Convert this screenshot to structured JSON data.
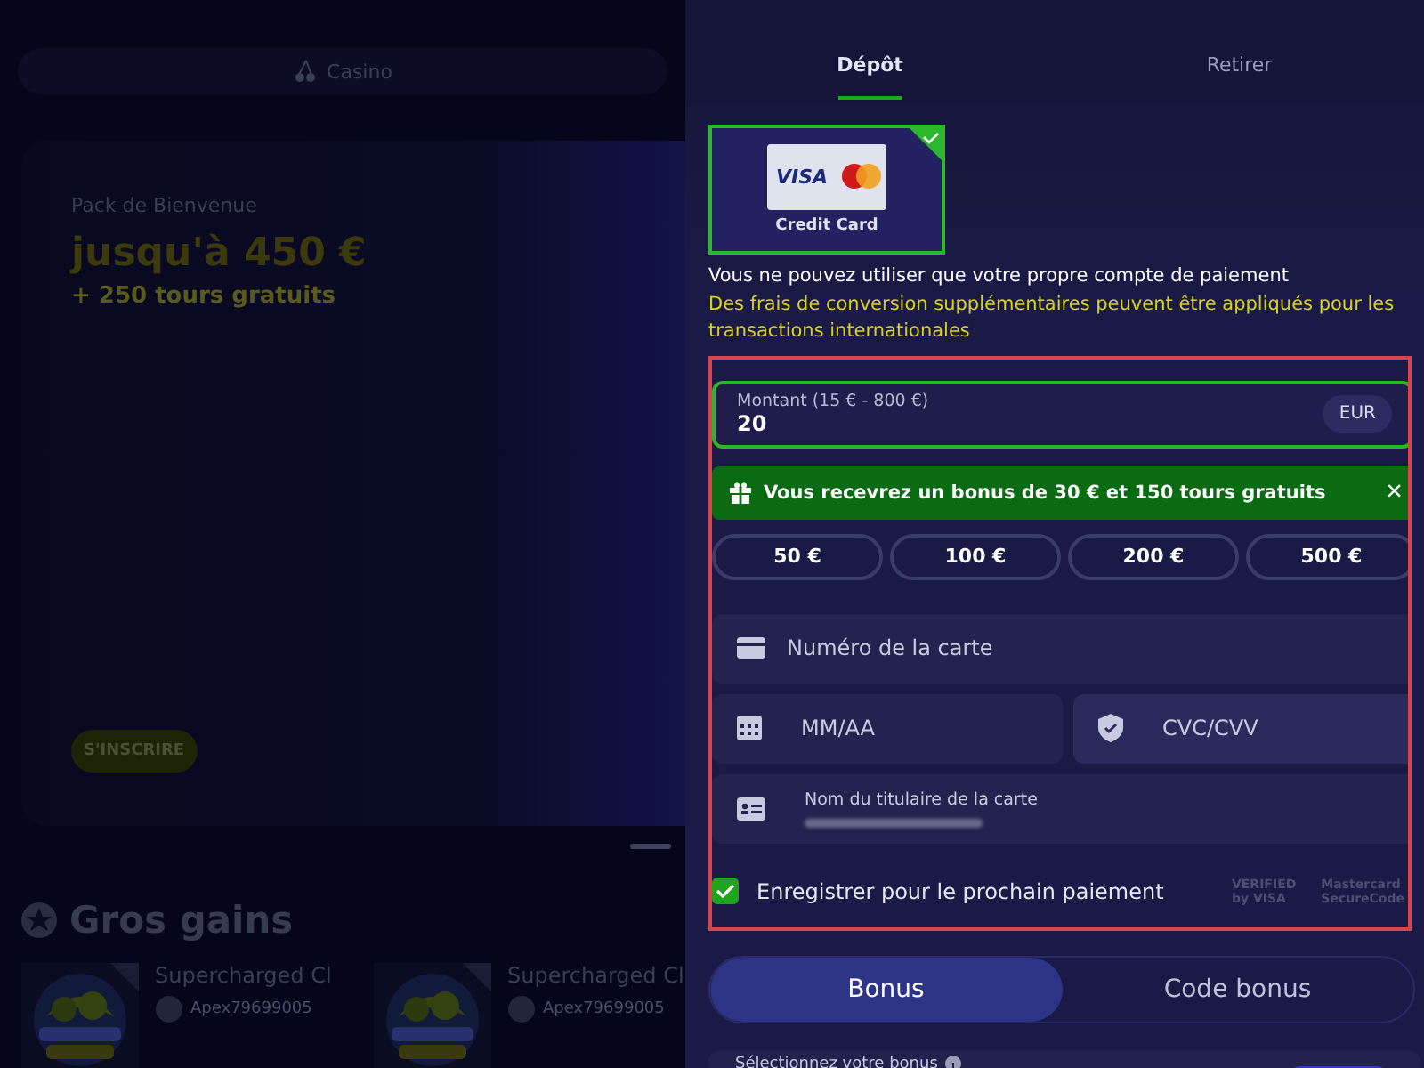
{
  "background_page": {
    "nav": {
      "label": "Casino"
    },
    "promo": {
      "title": "Pack de Bienvenue",
      "amount": "jusqu'à 450 €",
      "extra": "+ 250 tours gratuits",
      "button": "S'INSCRIRE"
    },
    "big_wins": {
      "title": "Gros gains",
      "items": [
        {
          "kind": "picture",
          "game": "Supercharged Cl",
          "player": "Apex79699005"
        },
        {
          "kind": "picture",
          "game": "Supercharged Cl",
          "player": "Apex79699005"
        }
      ]
    }
  },
  "tabs": [
    {
      "label": "Dépôt",
      "selected": true
    },
    {
      "label": "Retirer",
      "selected": false
    }
  ],
  "methods": [
    {
      "label": "Credit Card",
      "logo_text": "VISA",
      "selected": true
    }
  ],
  "notes": [
    {
      "kind": "plain",
      "text": "Vous ne pouvez utiliser que votre propre compte de paiement"
    },
    {
      "kind": "warning",
      "text": "Des frais de conversion supplémentaires peuvent être appliqués pour les transactions internationales"
    }
  ],
  "amount_field": {
    "label": "Montant (15 € - 800 €)",
    "value": "20",
    "currency": "EUR"
  },
  "bonus_banner": {
    "text": "Vous recevrez un bonus de 30 € et 150 tours gratuits",
    "close": "×"
  },
  "quick_amounts": [
    {
      "label": "50 €"
    },
    {
      "label": "100 €"
    },
    {
      "label": "200 €"
    },
    {
      "label": "500 €"
    }
  ],
  "card_form": {
    "card_number": {
      "placeholder": "Numéro de la carte"
    },
    "expiry": {
      "placeholder": "MM/AA"
    },
    "cvc": {
      "placeholder": "CVC/CVV"
    },
    "holder": {
      "label": "Nom du titulaire de la carte"
    }
  },
  "save_card": {
    "label": "Enregistrer pour le prochain paiement",
    "checked": true
  },
  "security_logos": [
    {
      "line1": "VERIFIED",
      "line2": "by VISA"
    },
    {
      "line1": "Mastercard",
      "line2": "SecureCode"
    }
  ],
  "bonus_toggle": [
    {
      "label": "Bonus",
      "selected": true
    },
    {
      "label": "Code bonus",
      "selected": false
    }
  ],
  "bonus_select": {
    "label": "Sélectionnez votre bonus"
  }
}
